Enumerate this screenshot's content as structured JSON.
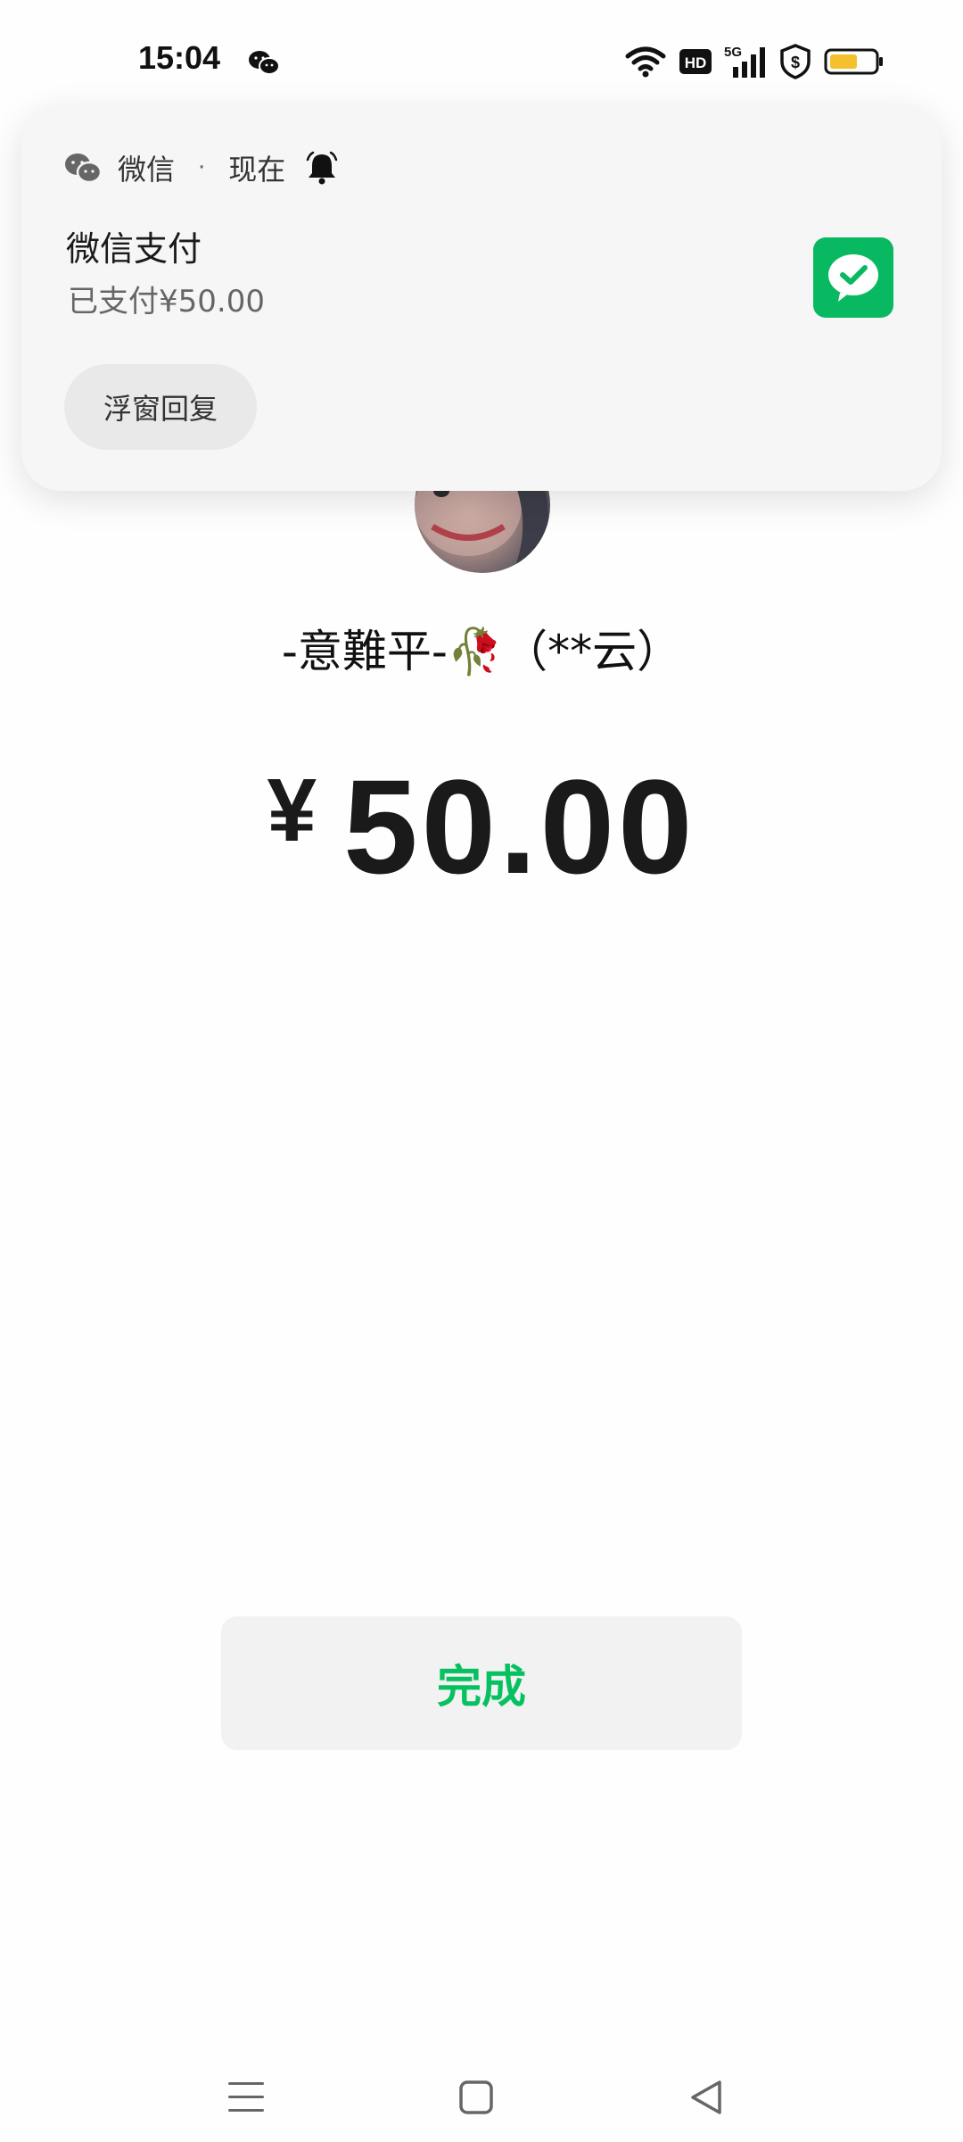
{
  "status_bar": {
    "time": "15:04",
    "notification_icon": "wechat-icon",
    "icons": [
      "wifi-icon",
      "hd-icon",
      "5g-signal-icon",
      "shield-dollar-icon",
      "battery-icon"
    ],
    "network_label": "5G",
    "hd_label": "HD",
    "battery_color": "#f5c02e"
  },
  "notification": {
    "app_name": "微信",
    "separator": "·",
    "time": "现在",
    "title": "微信支付",
    "text": "已支付¥50.00",
    "reply_button": "浮窗回复",
    "thumb_color": "#09b962"
  },
  "payment": {
    "payee": "-意難平-🥀（**云）",
    "currency": "¥",
    "amount": "50.00",
    "done_button": "完成",
    "accent_color": "#07c160"
  },
  "nav_bar": {
    "buttons": [
      "menu-icon",
      "home-icon",
      "back-icon"
    ]
  }
}
